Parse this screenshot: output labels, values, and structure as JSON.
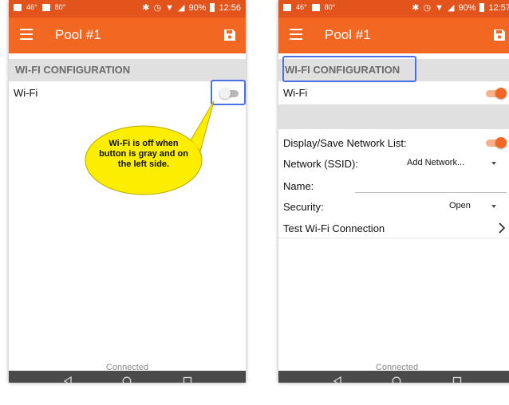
{
  "colors": {
    "statusbar": "#e3541c",
    "appbar": "#f26722",
    "highlight": "#4a6fe0",
    "callout_fill": "#fdee00",
    "navbar": "#4a4a4a"
  },
  "left_screen": {
    "status": {
      "left_text": "46°",
      "extra_text": "80°",
      "battery": "90%",
      "time": "12:56"
    },
    "appbar": {
      "title": "Pool #1",
      "menu_icon": "hamburger-icon",
      "save_icon": "save-icon"
    },
    "section_title": "WI-FI CONFIGURATION",
    "wifi": {
      "label": "Wi-Fi",
      "on": false
    },
    "callout_text": "Wi-Fi is off when button is gray and on the left side.",
    "footer_status": "Connected"
  },
  "right_screen": {
    "status": {
      "left_text": "46°",
      "extra_text": "80°",
      "battery": "90%",
      "time": "12:57"
    },
    "appbar": {
      "title": "Pool #1",
      "menu_icon": "hamburger-icon",
      "save_icon": "save-icon"
    },
    "section_title": "WI-FI CONFIGURATION",
    "wifi": {
      "label": "Wi-Fi",
      "on": true
    },
    "display_save": {
      "label": "Display/Save Network List:",
      "on": true
    },
    "network": {
      "label": "Network (SSID):",
      "value": "Add Network..."
    },
    "name": {
      "label": "Name:",
      "value": ""
    },
    "security": {
      "label": "Security:",
      "value": "Open"
    },
    "test_connection": {
      "label": "Test Wi-Fi Connection"
    },
    "footer_status": "Connected"
  },
  "navbar": {
    "back_icon": "back-triangle-icon",
    "home_icon": "home-circle-icon",
    "recents_icon": "recents-square-icon"
  }
}
